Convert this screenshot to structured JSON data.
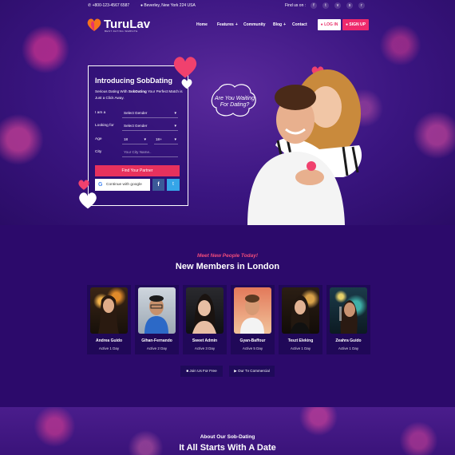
{
  "topbar": {
    "phone": "+800-123-4567 6587",
    "address": "Beverley, New York 224 USA",
    "find_us": "Find us on :",
    "social_icons": [
      "facebook-icon",
      "twitter-icon",
      "vimeo-icon",
      "skype-icon",
      "rss-icon"
    ]
  },
  "brand": {
    "name": "TuruLav",
    "tagline": "BEST DATING WEBSITE",
    "accent": "#ee2a6c"
  },
  "nav": {
    "items": [
      {
        "label": "Home",
        "has_submenu": false
      },
      {
        "label": "Features",
        "has_submenu": true
      },
      {
        "label": "Community",
        "has_submenu": false
      },
      {
        "label": "Blog",
        "has_submenu": true
      },
      {
        "label": "Contact",
        "has_submenu": false
      }
    ],
    "login_label": "LOG IN",
    "signup_label": "SIGN UP"
  },
  "hero_form": {
    "title": "Introducing SobDating",
    "subtitle_pre": "Serious Dating With ",
    "subtitle_bold": "SobDating",
    "subtitle_post": " Your Perfect Match is Just a Click Away.",
    "i_am_label": "I am a",
    "i_am_value": "Select Gender",
    "looking_for_label": "Looking for",
    "looking_for_value": "Select Gender",
    "age_label": "Age",
    "age_from": "18",
    "age_to": "18+",
    "city_label": "City",
    "city_placeholder": "Your City Name..",
    "find_button": "Find Your Partner",
    "google_button": "Continue with google",
    "facebook_label": "f",
    "twitter_label": "t"
  },
  "hero_bubble": {
    "text": "Are You Waiting For Dating?"
  },
  "members": {
    "kicker": "Meet New People Today!",
    "title": "New Members in London",
    "list": [
      {
        "name": "Andrea Guido",
        "active": "Active 1 Day"
      },
      {
        "name": "Gihan-Fernando",
        "active": "Active 2 Day"
      },
      {
        "name": "Sweet Admin",
        "active": "Active 3 Day"
      },
      {
        "name": "Gyan-Baffour",
        "active": "Active 5 Day"
      },
      {
        "name": "Teszt Eleking",
        "active": "Active 1 Day"
      },
      {
        "name": "Zeahra Guido",
        "active": "Active 1 Day"
      }
    ],
    "join_button": "Join Us For Free",
    "tv_button": "Our Tv Commercial"
  },
  "about": {
    "kicker": "About Our Sob-Dating",
    "title": "It All Starts With A Date"
  }
}
